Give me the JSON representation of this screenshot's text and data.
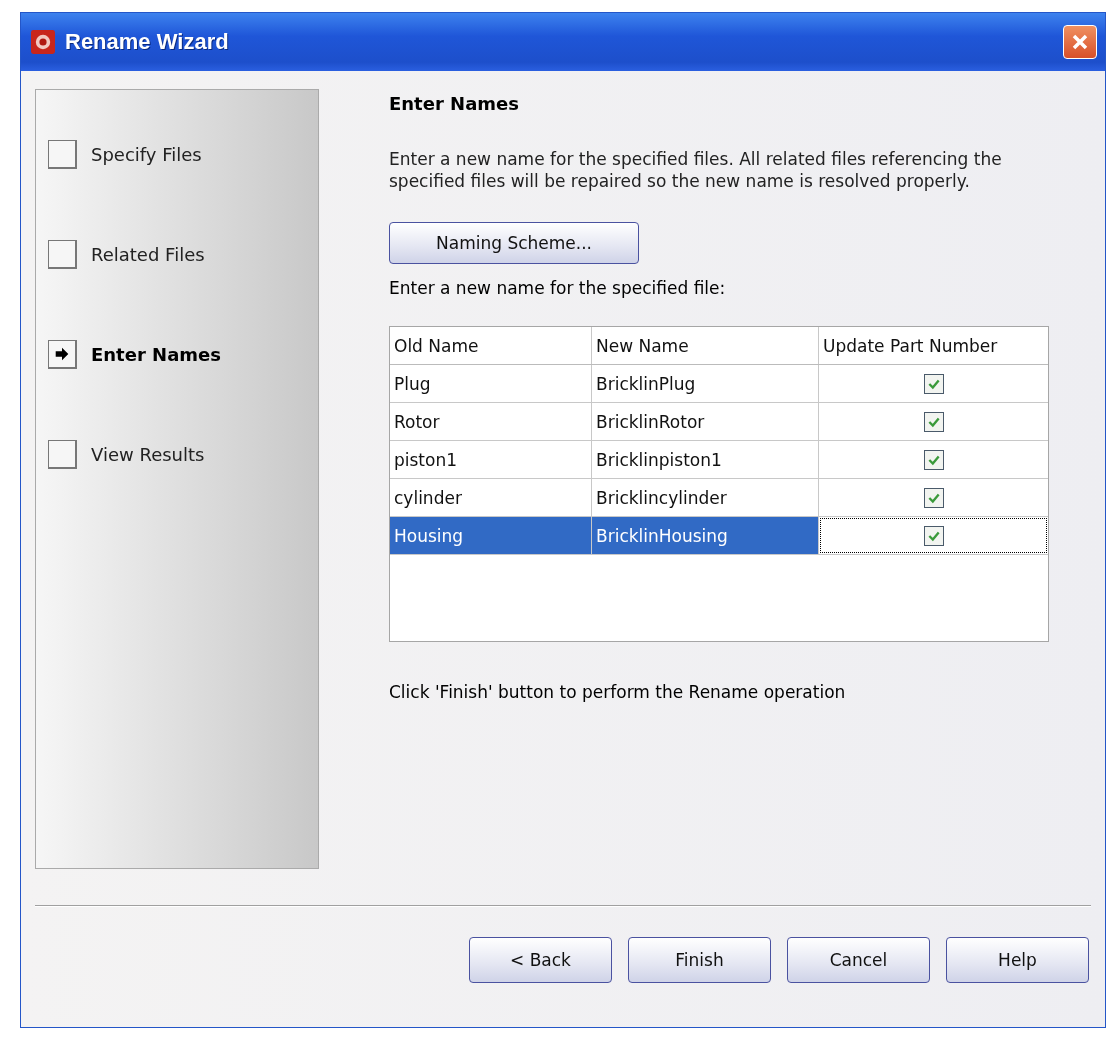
{
  "window": {
    "title": "Rename Wizard"
  },
  "steps": [
    {
      "label": "Specify Files",
      "current": false
    },
    {
      "label": "Related Files",
      "current": false
    },
    {
      "label": "Enter Names",
      "current": true
    },
    {
      "label": "View Results",
      "current": false
    }
  ],
  "heading": "Enter Names",
  "description": "Enter a new name for the specified files.  All related files referencing the specified files will be repaired so the new name is resolved properly.",
  "naming_button": "Naming Scheme...",
  "table_label": "Enter a new name for the specified file:",
  "table": {
    "columns": [
      "Old Name",
      "New Name",
      "Update Part Number"
    ],
    "rows": [
      {
        "old_name": "Plug",
        "new_name": "BricklinPlug",
        "checked": true,
        "selected": false
      },
      {
        "old_name": "Rotor",
        "new_name": "BricklinRotor",
        "checked": true,
        "selected": false
      },
      {
        "old_name": "piston1",
        "new_name": "Bricklinpiston1",
        "checked": true,
        "selected": false
      },
      {
        "old_name": "cylinder",
        "new_name": "Bricklincylinder",
        "checked": true,
        "selected": false
      },
      {
        "old_name": "Housing",
        "new_name": "BricklinHousing",
        "checked": true,
        "selected": true
      }
    ]
  },
  "footer_note": "Click 'Finish' button to perform the Rename operation",
  "buttons": [
    "< Back",
    "Finish",
    "Cancel",
    "Help"
  ]
}
